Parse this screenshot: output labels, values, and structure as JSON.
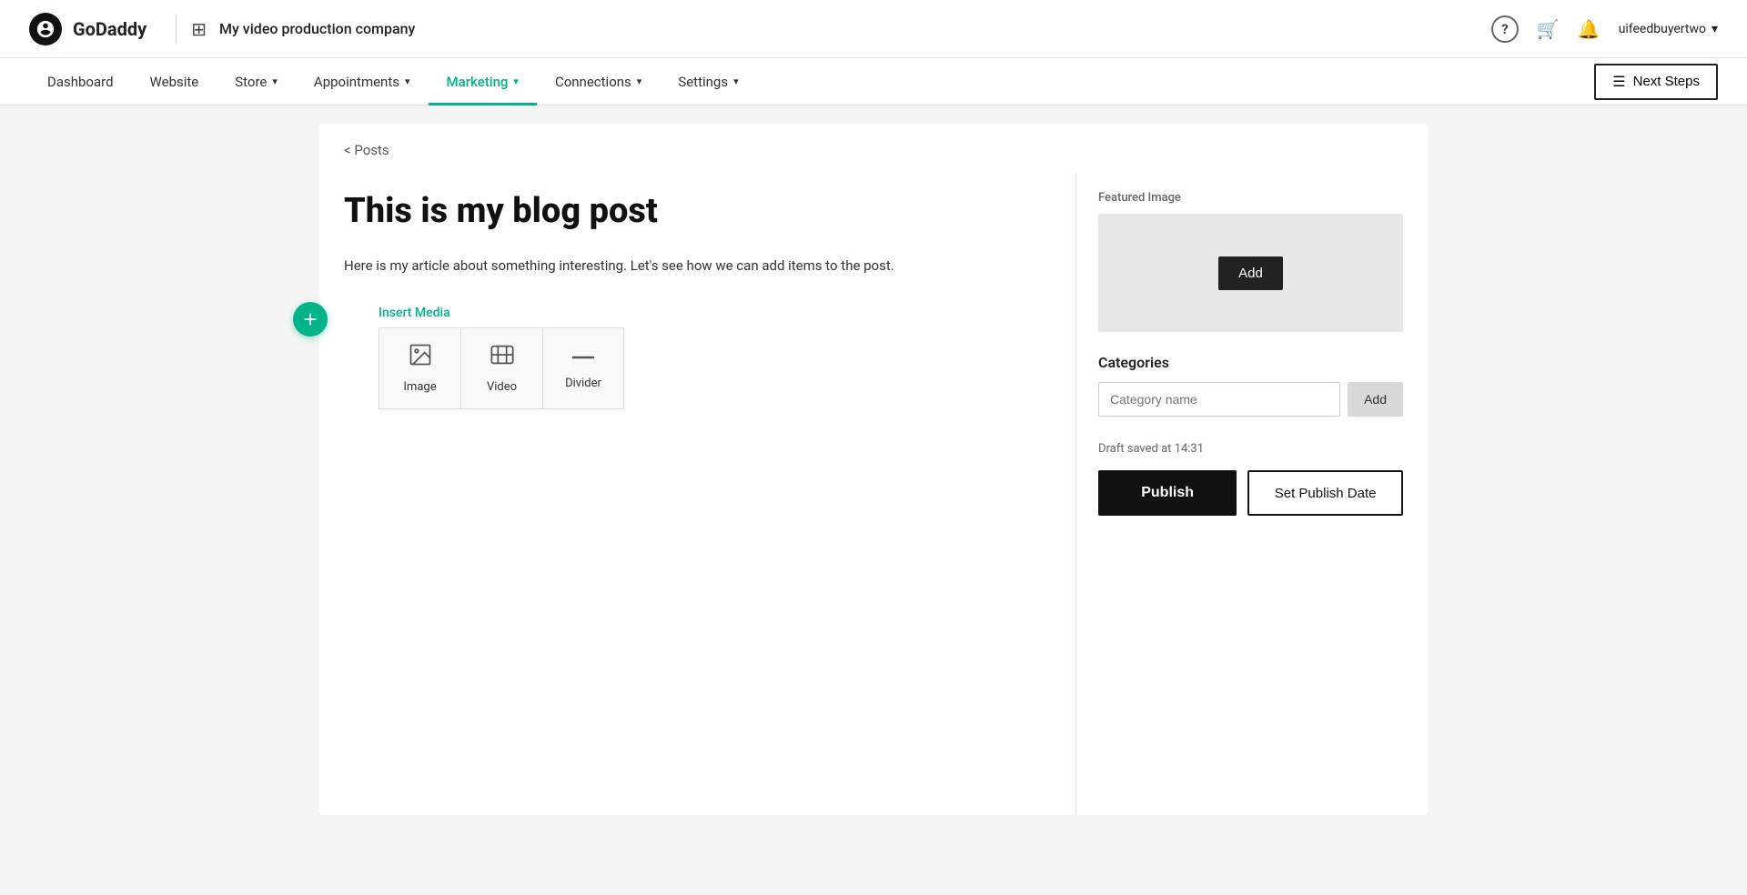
{
  "topbar": {
    "logo_text": "GoDaddy",
    "site_name": "My video production company",
    "help_icon": "?",
    "cart_icon": "🛒",
    "bell_icon": "🔔",
    "user_name": "uifeedbuyertwo",
    "next_steps_label": "Next Steps"
  },
  "mainnav": {
    "items": [
      {
        "label": "Dashboard",
        "active": false,
        "has_dropdown": false
      },
      {
        "label": "Website",
        "active": false,
        "has_dropdown": false
      },
      {
        "label": "Store",
        "active": false,
        "has_dropdown": true
      },
      {
        "label": "Appointments",
        "active": false,
        "has_dropdown": true
      },
      {
        "label": "Marketing",
        "active": true,
        "has_dropdown": true
      },
      {
        "label": "Connections",
        "active": false,
        "has_dropdown": true
      },
      {
        "label": "Settings",
        "active": false,
        "has_dropdown": true
      }
    ]
  },
  "breadcrumb": {
    "back_label": "< Posts"
  },
  "editor": {
    "post_title": "This is my blog post",
    "post_body": "Here is my article about something interesting. Let's see how we can add items to the post.",
    "insert_media_label": "Insert Media",
    "media_options": [
      {
        "label": "Image"
      },
      {
        "label": "Video"
      },
      {
        "label": "Divider"
      }
    ]
  },
  "sidebar": {
    "featured_image_label": "Featured Image",
    "featured_image_add_btn": "Add",
    "categories_label": "Categories",
    "category_placeholder": "Category name",
    "category_add_btn": "Add",
    "draft_status": "Draft saved at 14:31",
    "publish_btn": "Publish",
    "set_publish_date_btn": "Set Publish Date"
  },
  "colors": {
    "accent": "#00b388",
    "dark": "#111111",
    "border": "#e0e0e0"
  }
}
